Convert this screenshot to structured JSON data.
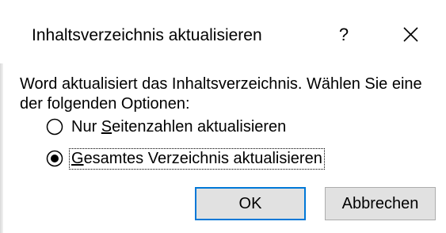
{
  "dialog": {
    "title": "Inhaltsverzeichnis aktualisieren",
    "help_label": "?",
    "close_icon": "close-icon",
    "message": "Word aktualisiert das Inhaltsverzeichnis. Wählen Sie eine der folgenden Optionen:",
    "options": [
      {
        "accel": "S",
        "label_before": "Nur ",
        "label_after": "eitenzahlen aktualisieren",
        "selected": false
      },
      {
        "accel": "G",
        "label_before": "",
        "label_after": "esamtes Verzeichnis aktualisieren",
        "selected": true
      }
    ],
    "ok_label": "OK",
    "cancel_label": "Abbrechen"
  },
  "colors": {
    "focus_border": "#0078d7",
    "button_face": "#e1e1e1",
    "button_border": "#adadad"
  }
}
